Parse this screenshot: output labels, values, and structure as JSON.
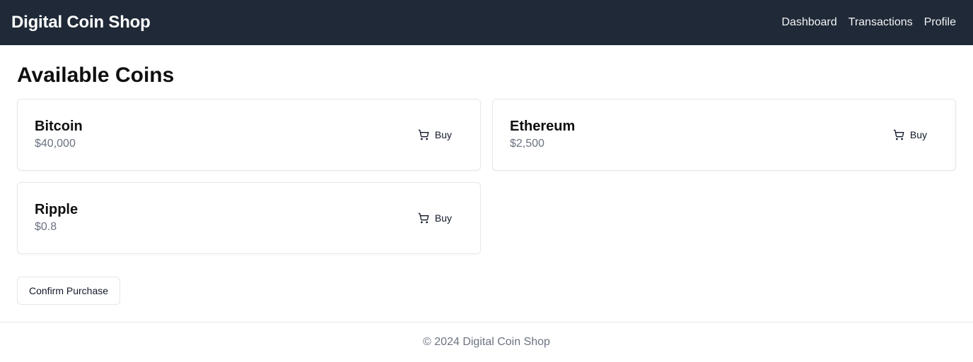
{
  "header": {
    "brand": "Digital Coin Shop",
    "nav": [
      "Dashboard",
      "Transactions",
      "Profile"
    ]
  },
  "main": {
    "title": "Available Coins",
    "coins": [
      {
        "name": "Bitcoin",
        "price": "$40,000",
        "buy_label": "Buy"
      },
      {
        "name": "Ethereum",
        "price": "$2,500",
        "buy_label": "Buy"
      },
      {
        "name": "Ripple",
        "price": "$0.8",
        "buy_label": "Buy"
      }
    ],
    "confirm_label": "Confirm Purchase"
  },
  "footer": {
    "text": "© 2024 Digital Coin Shop"
  },
  "colors": {
    "navbar_bg": "#1f2937",
    "price_text": "#6b7280",
    "border": "#e5e7eb"
  },
  "icons": {
    "buy": "cart-icon"
  }
}
